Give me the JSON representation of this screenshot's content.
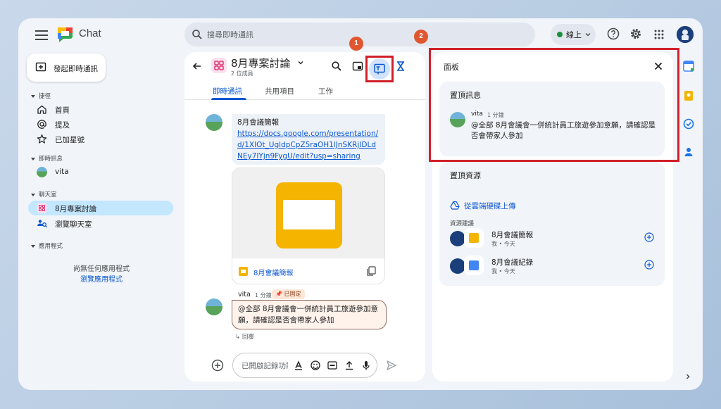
{
  "app": {
    "title": "Chat"
  },
  "search": {
    "placeholder": "搜尋即時通訊"
  },
  "status": {
    "label": "線上"
  },
  "nav": {
    "new_chat_label": "發起即時通訊",
    "shortcuts_label": "捷徑",
    "shortcuts": [
      "首頁",
      "提及",
      "已加星號"
    ],
    "dm_label": "即時訊息",
    "dms": [
      "vita"
    ],
    "spaces_label": "聊天室",
    "spaces": [
      "8月專案討論",
      "瀏覽聊天室"
    ],
    "apps_label": "應用程式",
    "no_apps_text": "尚無任何應用程式",
    "browse_apps_label": "瀏覽應用程式"
  },
  "chat": {
    "room_name": "8月專案討論",
    "members": "2 位成員",
    "tabs": [
      "即時通訊",
      "共用項目",
      "工作"
    ],
    "message1": {
      "title": "8月會議簡報",
      "link": "https://docs.google.com/presentation/d/1XIOt_UgldpCpZ5raOH1lJnSKRjIDLdNEy7IYjn9FygU/edit?usp=sharing",
      "card_title": "8月會議簡報"
    },
    "message2": {
      "sender": "vita",
      "time": "1 分鐘",
      "pinned_label": "已固定",
      "text": "@全部 8月會議會一併統計員工旅遊參加意願，請確認是否會帶家人參加",
      "reply_label": "回覆"
    },
    "composer_placeholder": "已開啟記錄功能"
  },
  "callouts": [
    "1",
    "2"
  ],
  "panel": {
    "title": "面板",
    "pinned_heading": "置頂訊息",
    "pinned_sender": "vita",
    "pinned_time": "1 分鐘",
    "pinned_text": "@全部 8月會議會一併統計員工旅遊參加意願，請確認是否會帶家人參加",
    "resources_heading": "置頂資源",
    "upload_label": "從雲端硬碟上傳",
    "suggested_label": "資源建議",
    "resources": [
      {
        "name": "8月會議簡報",
        "meta": "我 • 今天",
        "type": "slides"
      },
      {
        "name": "8月會議紀錄",
        "meta": "我 • 今天",
        "type": "docs"
      }
    ]
  },
  "colors": {
    "accent": "#0b57d0",
    "highlight_border": "#d0202a",
    "callout": "#e0572f",
    "online": "#1e8e3e",
    "slides": "#f4b400",
    "docs": "#4285f4"
  }
}
